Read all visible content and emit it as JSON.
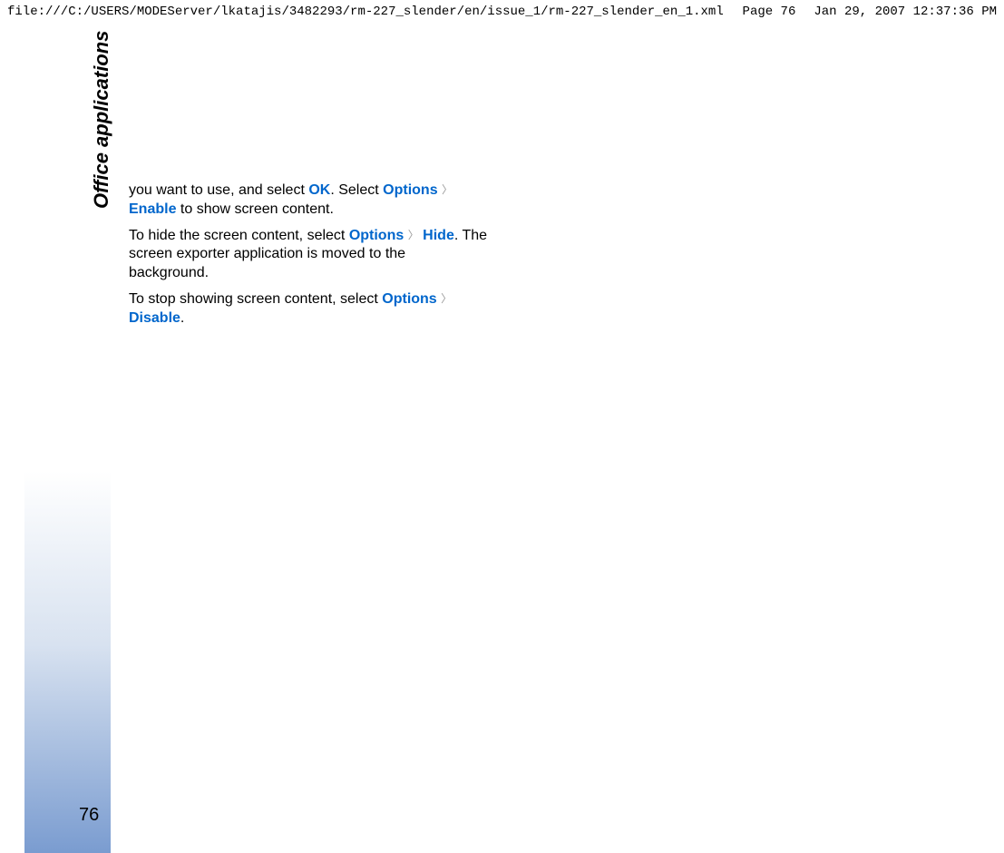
{
  "header": {
    "file_path": "file:///C:/USERS/MODEServer/lkatajis/3482293/rm-227_slender/en/issue_1/rm-227_slender_en_1.xml",
    "page_label": "Page 76",
    "timestamp": "Jan 29, 2007 12:37:36 PM"
  },
  "section_title": "Office applications",
  "page_number": "76",
  "content": {
    "p1_text1": "you want to use, and select ",
    "p1_link1": "OK",
    "p1_text2": ". Select ",
    "p1_link2": "Options",
    "p1_text3": " ",
    "p1_link3": "Enable",
    "p1_text4": " to show screen content.",
    "p2_text1": "To hide the screen content, select ",
    "p2_link1": "Options",
    "p2_text2": " ",
    "p2_link2": "Hide",
    "p2_text3": ". The screen exporter application is moved to the background.",
    "p3_text1": "To stop showing screen content, select ",
    "p3_link1": "Options",
    "p3_text2": " ",
    "p3_link2": "Disable",
    "p3_text3": "."
  },
  "arrow_char": "〉"
}
